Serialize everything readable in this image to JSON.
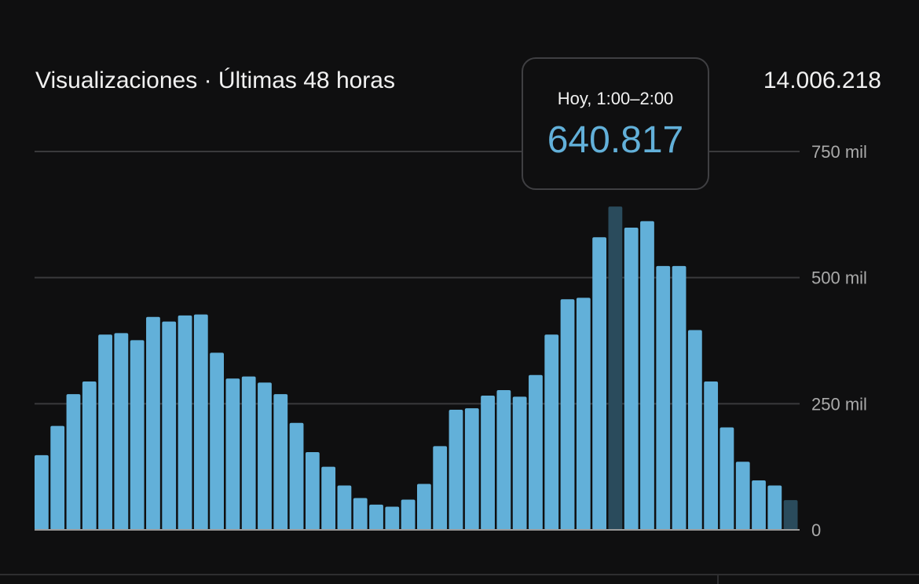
{
  "header": {
    "title": "Visualizaciones · Últimas 48 horas",
    "total": "14.006.218"
  },
  "tooltip": {
    "label": "Hoy, 1:00–2:00",
    "value": "640.817"
  },
  "colors": {
    "bar": "#62b0d9",
    "bar_dim": "#2a4b5c",
    "grid": "#3a3a3c",
    "tick_text": "#aaaaaa",
    "accent": "#62b0d9"
  },
  "chart_data": {
    "type": "bar",
    "ylim": [
      0,
      750000
    ],
    "yticks": [
      {
        "value": 0,
        "label": "0"
      },
      {
        "value": 250000,
        "label": "250 mil"
      },
      {
        "value": 500000,
        "label": "500 mil"
      },
      {
        "value": 750000,
        "label": "750 mil"
      }
    ],
    "grid": true,
    "values": [
      148000,
      206000,
      269000,
      294000,
      387000,
      390000,
      376000,
      422000,
      413000,
      425000,
      427000,
      351000,
      300000,
      304000,
      292000,
      269000,
      212000,
      154000,
      125000,
      88000,
      63000,
      50000,
      46000,
      60000,
      91000,
      166000,
      238000,
      241000,
      266000,
      277000,
      264000,
      307000,
      387000,
      457000,
      460000,
      580000,
      640817,
      599000,
      612000,
      523000,
      523000,
      396000,
      294000,
      203000,
      135000,
      98000,
      88000,
      59000
    ],
    "highlight_index": 36,
    "partial_index": 47
  }
}
